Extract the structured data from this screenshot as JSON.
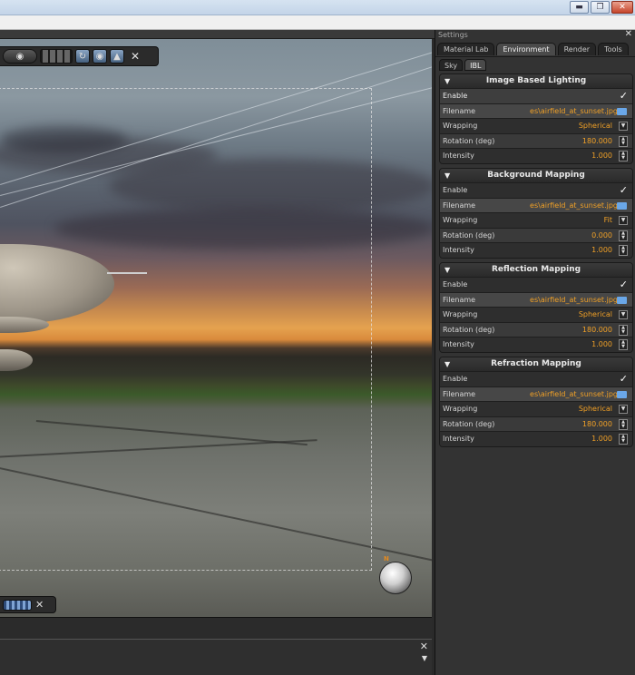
{
  "window": {
    "minimize_icon": "minimize-icon",
    "maximize_icon": "maximize-icon",
    "close_icon": "close-icon"
  },
  "settings": {
    "title": "Settings",
    "tabs": [
      "Material Lab",
      "Environment",
      "Render",
      "Tools"
    ],
    "active_tab": "Environment",
    "subtabs": [
      "Sky",
      "IBL"
    ],
    "active_subtab": "IBL",
    "sections": [
      {
        "title": "Image Based Lighting",
        "enable_label": "Enable",
        "enabled": true,
        "filename_label": "Filename",
        "filename": "es\\airfield_at_sunset.jpg",
        "wrapping_label": "Wrapping",
        "wrapping": "Spherical",
        "rotation_label": "Rotation (deg)",
        "rotation": "180.000",
        "intensity_label": "Intensity",
        "intensity": "1.000"
      },
      {
        "title": "Background Mapping",
        "enable_label": "Enable",
        "enabled": true,
        "filename_label": "Filename",
        "filename": "es\\airfield_at_sunset.jpg",
        "wrapping_label": "Wrapping",
        "wrapping": "Fit",
        "rotation_label": "Rotation (deg)",
        "rotation": "0.000",
        "intensity_label": "Intensity",
        "intensity": "1.000"
      },
      {
        "title": "Reflection Mapping",
        "enable_label": "Enable",
        "enabled": true,
        "filename_label": "Filename",
        "filename": "es\\airfield_at_sunset.jpg",
        "wrapping_label": "Wrapping",
        "wrapping": "Spherical",
        "rotation_label": "Rotation (deg)",
        "rotation": "180.000",
        "intensity_label": "Intensity",
        "intensity": "1.000"
      },
      {
        "title": "Refraction Mapping",
        "enable_label": "Enable",
        "enabled": true,
        "filename_label": "Filename",
        "filename": "es\\airfield_at_sunset.jpg",
        "wrapping_label": "Wrapping",
        "wrapping": "Spherical",
        "rotation_label": "Rotation (deg)",
        "rotation": "180.000",
        "intensity_label": "Intensity",
        "intensity": "1.000"
      }
    ]
  },
  "viewport": {
    "compass_label": "N"
  },
  "colors": {
    "accent_value": "#f0a027",
    "panel_bg": "#333333"
  }
}
